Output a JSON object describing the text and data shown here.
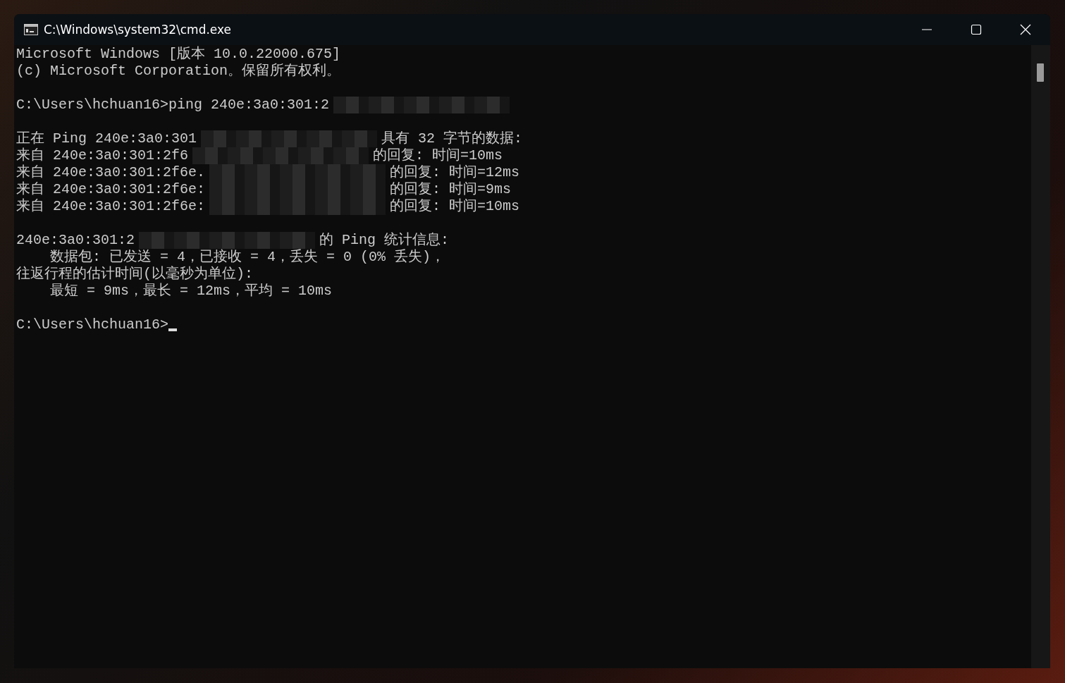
{
  "window": {
    "title": "C:\\Windows\\system32\\cmd.exe"
  },
  "console": {
    "blocks": [
      {
        "lines": [
          {
            "parts": [
              {
                "kind": "text",
                "text": "Microsoft Windows [版本 10.0.22000.675]"
              }
            ]
          },
          {
            "parts": [
              {
                "kind": "text",
                "text": "(c) Microsoft Corporation。保留所有权利。"
              }
            ]
          }
        ]
      },
      {
        "lines": [
          {
            "parts": [
              {
                "kind": "text",
                "text": "C:\\Users\\hchuan16>ping 240e:3a0:301:2"
              },
              {
                "kind": "redacted"
              }
            ]
          }
        ]
      },
      {
        "lines": [
          {
            "parts": [
              {
                "kind": "text",
                "text": "正在 Ping 240e:3a0:301"
              },
              {
                "kind": "redacted"
              },
              {
                "kind": "text",
                "text": "具有 32 字节的数据:"
              }
            ]
          },
          {
            "parts": [
              {
                "kind": "text",
                "text": "来自 240e:3a0:301:2f6"
              },
              {
                "kind": "redacted"
              },
              {
                "kind": "text",
                "text": "的回复: 时间=10ms"
              }
            ]
          },
          {
            "parts": [
              {
                "kind": "text",
                "text": "来自 240e:3a0:301:2f6e."
              },
              {
                "kind": "redacted"
              },
              {
                "kind": "text",
                "text": "的回复: 时间=12ms"
              }
            ]
          },
          {
            "parts": [
              {
                "kind": "text",
                "text": "来自 240e:3a0:301:2f6e:"
              },
              {
                "kind": "redacted"
              },
              {
                "kind": "text",
                "text": "的回复: 时间=9ms"
              }
            ]
          },
          {
            "parts": [
              {
                "kind": "text",
                "text": "来自 240e:3a0:301:2f6e:"
              },
              {
                "kind": "redacted"
              },
              {
                "kind": "text",
                "text": "的回复: 时间=10ms"
              }
            ]
          }
        ]
      },
      {
        "lines": [
          {
            "parts": [
              {
                "kind": "text",
                "text": "240e:3a0:301:2"
              },
              {
                "kind": "redacted"
              },
              {
                "kind": "text",
                "text": "的 Ping 统计信息:"
              }
            ]
          },
          {
            "parts": [
              {
                "kind": "text",
                "text": "    数据包: 已发送 = 4，已接收 = 4，丢失 = 0 (0% 丢失)，"
              }
            ]
          },
          {
            "parts": [
              {
                "kind": "text",
                "text": "往返行程的估计时间(以毫秒为单位):"
              }
            ]
          },
          {
            "parts": [
              {
                "kind": "text",
                "text": "    最短 = 9ms，最长 = 12ms，平均 = 10ms"
              }
            ]
          }
        ]
      },
      {
        "lines": [
          {
            "parts": [
              {
                "kind": "text",
                "text": "C:\\Users\\hchuan16>"
              },
              {
                "kind": "cursor"
              }
            ]
          }
        ]
      }
    ]
  }
}
